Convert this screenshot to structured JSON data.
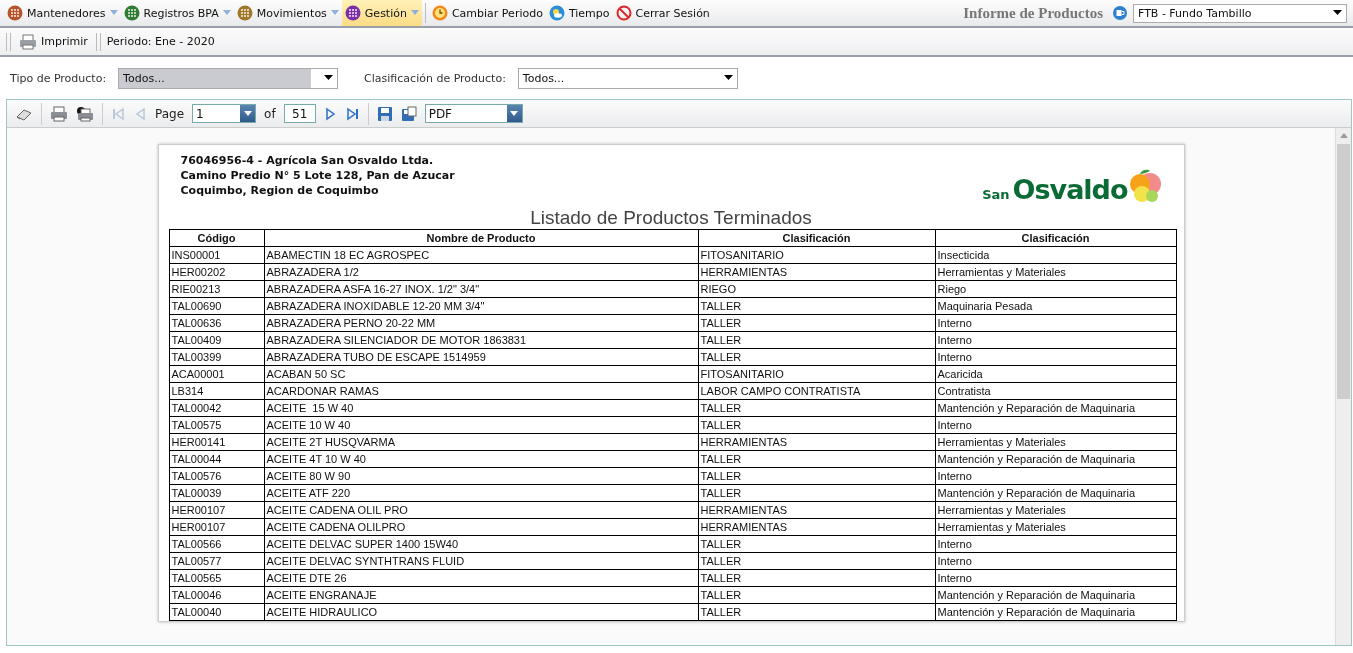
{
  "menu": {
    "items": [
      {
        "label": "Mantenedores",
        "kind": "dropdown",
        "color": "#b5532a",
        "selected": false
      },
      {
        "label": "Registros BPA",
        "kind": "dropdown",
        "color": "#2e7d32",
        "selected": false
      },
      {
        "label": "Movimientos",
        "kind": "dropdown",
        "color": "#a0782a",
        "selected": false
      },
      {
        "label": "Gestión",
        "kind": "dropdown",
        "color": "#7b2fa8",
        "selected": true
      },
      {
        "label": "Cambiar Periodo",
        "kind": "clock",
        "selected": false
      },
      {
        "label": "Tiempo",
        "kind": "weather",
        "selected": false
      },
      {
        "label": "Cerrar Sesión",
        "kind": "logout",
        "selected": false
      }
    ],
    "title": "Informe de Productos",
    "company_select": {
      "value": "FTB - Fundo Tambillo"
    }
  },
  "toolbar": {
    "print_button": "Imprimir",
    "period": "Periodo: Ene - 2020"
  },
  "filters": [
    {
      "label": "Tipo de Producto:",
      "value": "Todos...",
      "active": true
    },
    {
      "label": "Clasificación de Producto:",
      "value": "Todos...",
      "active": false
    }
  ],
  "viewer": {
    "nav": [
      {
        "kind": "first",
        "disabled": true
      },
      {
        "kind": "prev",
        "disabled": true
      },
      {
        "kind": "next",
        "disabled": false
      },
      {
        "kind": "last",
        "disabled": false
      }
    ],
    "page_label": "Page",
    "page": "1",
    "of_label": "of",
    "page_count": "51",
    "format": "PDF"
  },
  "report": {
    "company_lines": [
      "76046956-4 - Agrícola San Osvaldo Ltda.",
      "Camino Predio N° 5 Lote 128, Pan de Azucar",
      "Coquimbo, Region de Coquimbo"
    ],
    "logo": {
      "small": "San",
      "large": "Osvaldo"
    },
    "title": "Listado de Productos Terminados",
    "columns": [
      "Código",
      "Nombre de Producto",
      "Clasificación",
      "Clasificación"
    ],
    "rows": [
      [
        "INS00001",
        "ABAMECTIN 18 EC AGROSPEC",
        "FITOSANITARIO",
        "Insecticida"
      ],
      [
        "HER00202",
        "ABRAZADERA 1/2",
        "HERRAMIENTAS",
        "Herramientas y Materiales"
      ],
      [
        "RIE00213",
        "ABRAZADERA ASFA 16-27 INOX. 1/2\" 3/4\"",
        "RIEGO",
        "Riego"
      ],
      [
        "TAL00690",
        "ABRAZADERA INOXIDABLE 12-20 MM 3/4\"",
        "TALLER",
        "Maquinaria Pesada"
      ],
      [
        "TAL00636",
        "ABRAZADERA PERNO 20-22 MM",
        "TALLER",
        "Interno"
      ],
      [
        "TAL00409",
        "ABRAZADERA SILENCIADOR DE MOTOR 1863831",
        "TALLER",
        "Interno"
      ],
      [
        "TAL00399",
        "ABRAZADERA TUBO DE ESCAPE 1514959",
        "TALLER",
        "Interno"
      ],
      [
        "ACA00001",
        "ACABAN 50 SC",
        "FITOSANITARIO",
        "Acaricida"
      ],
      [
        "LB314",
        "ACARDONAR RAMAS",
        "LABOR CAMPO CONTRATISTA",
        "Contratista"
      ],
      [
        "TAL00042",
        "ACEITE  15 W 40",
        "TALLER",
        "Mantención y Reparación de Maquinaria"
      ],
      [
        "TAL00575",
        "ACEITE 10 W 40",
        "TALLER",
        "Interno"
      ],
      [
        "HER00141",
        "ACEITE 2T HUSQVARMA",
        "HERRAMIENTAS",
        "Herramientas y Materiales"
      ],
      [
        "TAL00044",
        "ACEITE 4T 10 W 40",
        "TALLER",
        "Mantención y Reparación de Maquinaria"
      ],
      [
        "TAL00576",
        "ACEITE 80 W 90",
        "TALLER",
        "Interno"
      ],
      [
        "TAL00039",
        "ACEITE ATF 220",
        "TALLER",
        "Mantención y Reparación de Maquinaria"
      ],
      [
        "HER00107",
        "ACEITE CADENA OLIL PRO",
        "HERRAMIENTAS",
        "Herramientas y Materiales"
      ],
      [
        "HER00107",
        "ACEITE CADENA OLILPRO",
        "HERRAMIENTAS",
        "Herramientas y Materiales"
      ],
      [
        "TAL00566",
        "ACEITE DELVAC SUPER 1400 15W40",
        "TALLER",
        "Interno"
      ],
      [
        "TAL00577",
        "ACEITE DELVAC SYNTHTRANS FLUID",
        "TALLER",
        "Interno"
      ],
      [
        "TAL00565",
        "ACEITE DTE 26",
        "TALLER",
        "Interno"
      ],
      [
        "TAL00046",
        "ACEITE ENGRANAJE",
        "TALLER",
        "Mantención y Reparación de Maquinaria"
      ],
      [
        "TAL00040",
        "ACEITE HIDRAULICO",
        "TALLER",
        "Mantención y Reparación de Maquinaria"
      ]
    ]
  }
}
